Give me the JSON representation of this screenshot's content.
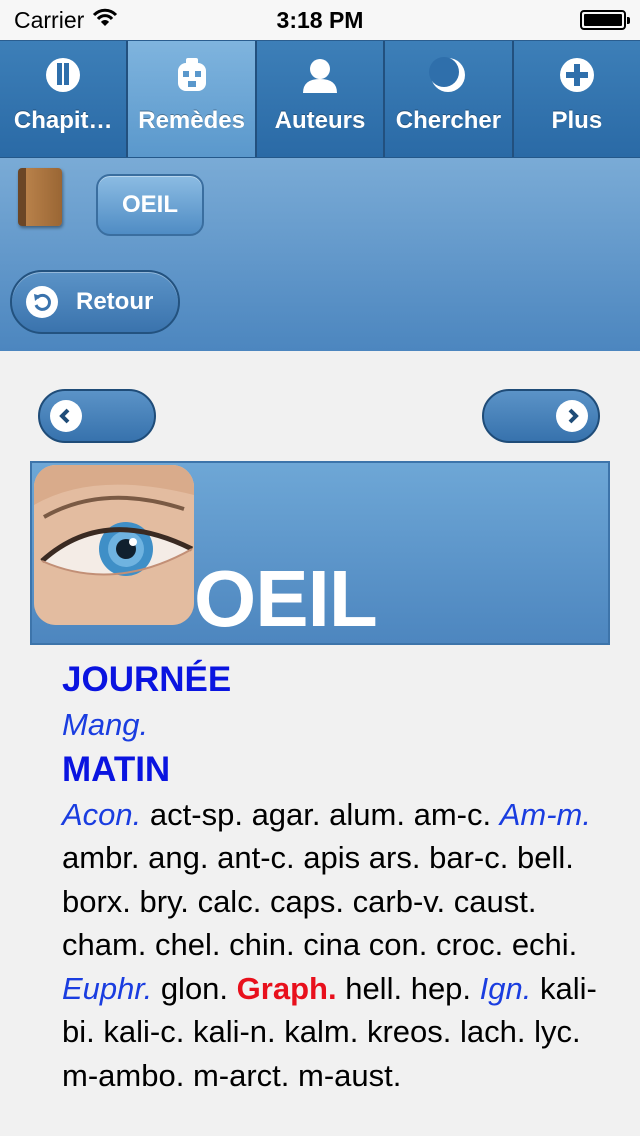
{
  "status_bar": {
    "carrier": "Carrier",
    "time": "3:18 PM"
  },
  "tabs": [
    {
      "label": "Chapit…",
      "icon": "chapter-icon",
      "active": false
    },
    {
      "label": "Remèdes",
      "icon": "remedy-bottle-icon",
      "active": true
    },
    {
      "label": "Auteurs",
      "icon": "person-icon",
      "active": false
    },
    {
      "label": "Chercher",
      "icon": "moon-icon",
      "active": false
    },
    {
      "label": "Plus",
      "icon": "plus-icon",
      "active": false
    }
  ],
  "header": {
    "chip_label": "OEIL",
    "back_label": "Retour"
  },
  "banner": {
    "title": "OEIL"
  },
  "sections": [
    {
      "heading": "JOURNÉE",
      "remedies": [
        {
          "text": "Mang.",
          "style": "italic"
        }
      ]
    },
    {
      "heading": "MATIN",
      "remedies": [
        {
          "text": "Acon.",
          "style": "italic"
        },
        {
          "text": "act-sp.",
          "style": "plain"
        },
        {
          "text": "agar.",
          "style": "plain"
        },
        {
          "text": "alum.",
          "style": "plain"
        },
        {
          "text": "am-c.",
          "style": "plain"
        },
        {
          "text": "Am-m.",
          "style": "italic"
        },
        {
          "text": "ambr.",
          "style": "plain"
        },
        {
          "text": "ang.",
          "style": "plain"
        },
        {
          "text": "ant-c.",
          "style": "plain"
        },
        {
          "text": "apis",
          "style": "plain"
        },
        {
          "text": "ars.",
          "style": "plain"
        },
        {
          "text": "bar-c.",
          "style": "plain"
        },
        {
          "text": "bell.",
          "style": "plain"
        },
        {
          "text": "borx.",
          "style": "plain"
        },
        {
          "text": "bry.",
          "style": "plain"
        },
        {
          "text": "calc.",
          "style": "plain"
        },
        {
          "text": "caps.",
          "style": "plain"
        },
        {
          "text": "carb-v.",
          "style": "plain"
        },
        {
          "text": "caust.",
          "style": "plain"
        },
        {
          "text": "cham.",
          "style": "plain"
        },
        {
          "text": "chel.",
          "style": "plain"
        },
        {
          "text": "chin.",
          "style": "plain"
        },
        {
          "text": "cina",
          "style": "plain"
        },
        {
          "text": "con.",
          "style": "plain"
        },
        {
          "text": "croc.",
          "style": "plain"
        },
        {
          "text": "echi.",
          "style": "plain"
        },
        {
          "text": "Euphr.",
          "style": "italic"
        },
        {
          "text": "glon.",
          "style": "plain"
        },
        {
          "text": "Graph.",
          "style": "bold"
        },
        {
          "text": "hell.",
          "style": "plain"
        },
        {
          "text": "hep.",
          "style": "plain"
        },
        {
          "text": "Ign.",
          "style": "italic"
        },
        {
          "text": "kali-bi.",
          "style": "plain"
        },
        {
          "text": "kali-c.",
          "style": "plain"
        },
        {
          "text": "kali-n.",
          "style": "plain"
        },
        {
          "text": "kalm.",
          "style": "plain"
        },
        {
          "text": "kreos.",
          "style": "plain"
        },
        {
          "text": "lach.",
          "style": "plain"
        },
        {
          "text": "lyc.",
          "style": "plain"
        },
        {
          "text": "m-ambo.",
          "style": "plain"
        },
        {
          "text": "m-arct.",
          "style": "plain"
        },
        {
          "text": "m-aust.",
          "style": "plain"
        }
      ]
    }
  ],
  "colors": {
    "heading": "#0a14e0",
    "italic_remedy": "#1a3de0",
    "bold_remedy": "#e8101c",
    "tab_bar": "#2f6fab"
  }
}
